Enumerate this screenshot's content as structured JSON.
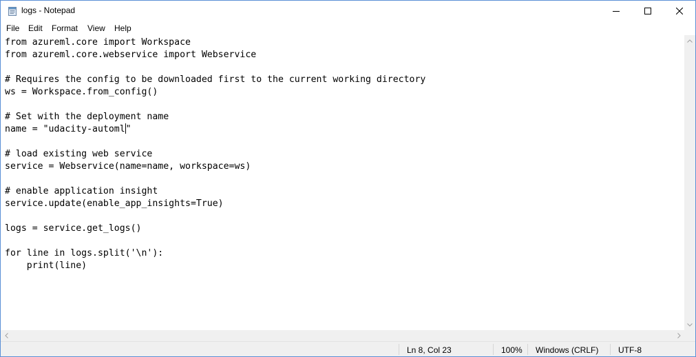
{
  "window": {
    "title": "logs - Notepad"
  },
  "icons": {
    "app": "notepad-icon",
    "minimize": "minimize-icon",
    "maximize": "maximize-icon",
    "close": "close-icon"
  },
  "menu": {
    "items": [
      "File",
      "Edit",
      "Format",
      "View",
      "Help"
    ]
  },
  "editor": {
    "lines": [
      "from azureml.core import Workspace",
      "from azureml.core.webservice import Webservice",
      "",
      "# Requires the config to be downloaded first to the current working directory",
      "ws = Workspace.from_config()",
      "",
      "# Set with the deployment name",
      "name = \"udacity-automl\"",
      "",
      "# load existing web service",
      "service = Webservice(name=name, workspace=ws)",
      "",
      "# enable application insight",
      "service.update(enable_app_insights=True)",
      "",
      "logs = service.get_logs()",
      "",
      "for line in logs.split('\\n'):",
      "    print(line)"
    ],
    "caret": {
      "line": 8,
      "col": 23
    }
  },
  "status": {
    "position": "Ln 8, Col 23",
    "zoom": "100%",
    "line_ending": "Windows (CRLF)",
    "encoding": "UTF-8"
  }
}
